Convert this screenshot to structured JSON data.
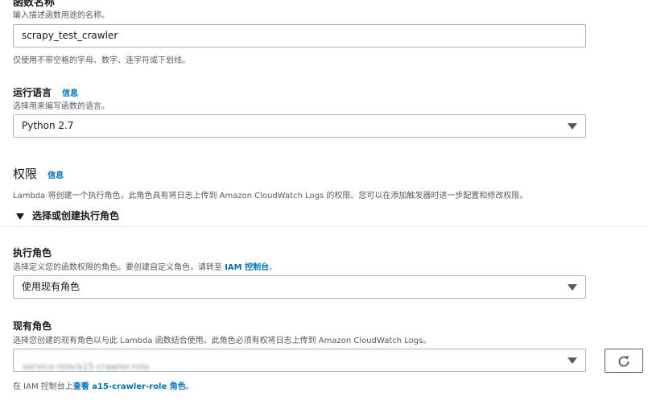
{
  "function_name": {
    "label": "函数名称",
    "description": "输入描述函数用途的名称。",
    "value": "scrapy_test_crawler",
    "constraint": "仅使用不带空格的字母、数字、连字符或下划线。"
  },
  "runtime": {
    "label": "运行语言",
    "info": "信息",
    "description": "选择用来编写函数的语言。",
    "selected": "Python 2.7"
  },
  "permissions": {
    "title": "权限",
    "info": "信息",
    "description": "Lambda 将创建一个执行角色，此角色具有将日志上传到 Amazon CloudWatch Logs 的权限。您可以在添加触发器时进一步配置和修改权限。",
    "expander_label": "选择或创建执行角色"
  },
  "execution_role": {
    "label": "执行角色",
    "description_prefix": "选择定义您的函数权限的角色。要创建自定义角色，请转至",
    "console_link": "IAM 控制台",
    "description_suffix": "。",
    "selected": "使用现有角色"
  },
  "existing_role": {
    "label": "现有角色",
    "description": "选择您创建的现有角色以与此 Lambda 函数结合使用。此角色必须有权将日志上传到 Amazon CloudWatch Logs。",
    "selected_obscured": "service-role/a15-crawler-role",
    "footer_prefix": "在 IAM 控制台上",
    "footer_link": "查看 a15-crawler-role 角色",
    "footer_suffix": "。"
  },
  "icons": {
    "dropdown": "caret-down-icon",
    "expander": "triangle-down-icon",
    "refresh": "refresh-icon"
  },
  "colors": {
    "link": "#0073bb",
    "border": "#aab7b8",
    "text": "#16191f",
    "hint": "#545b64"
  }
}
